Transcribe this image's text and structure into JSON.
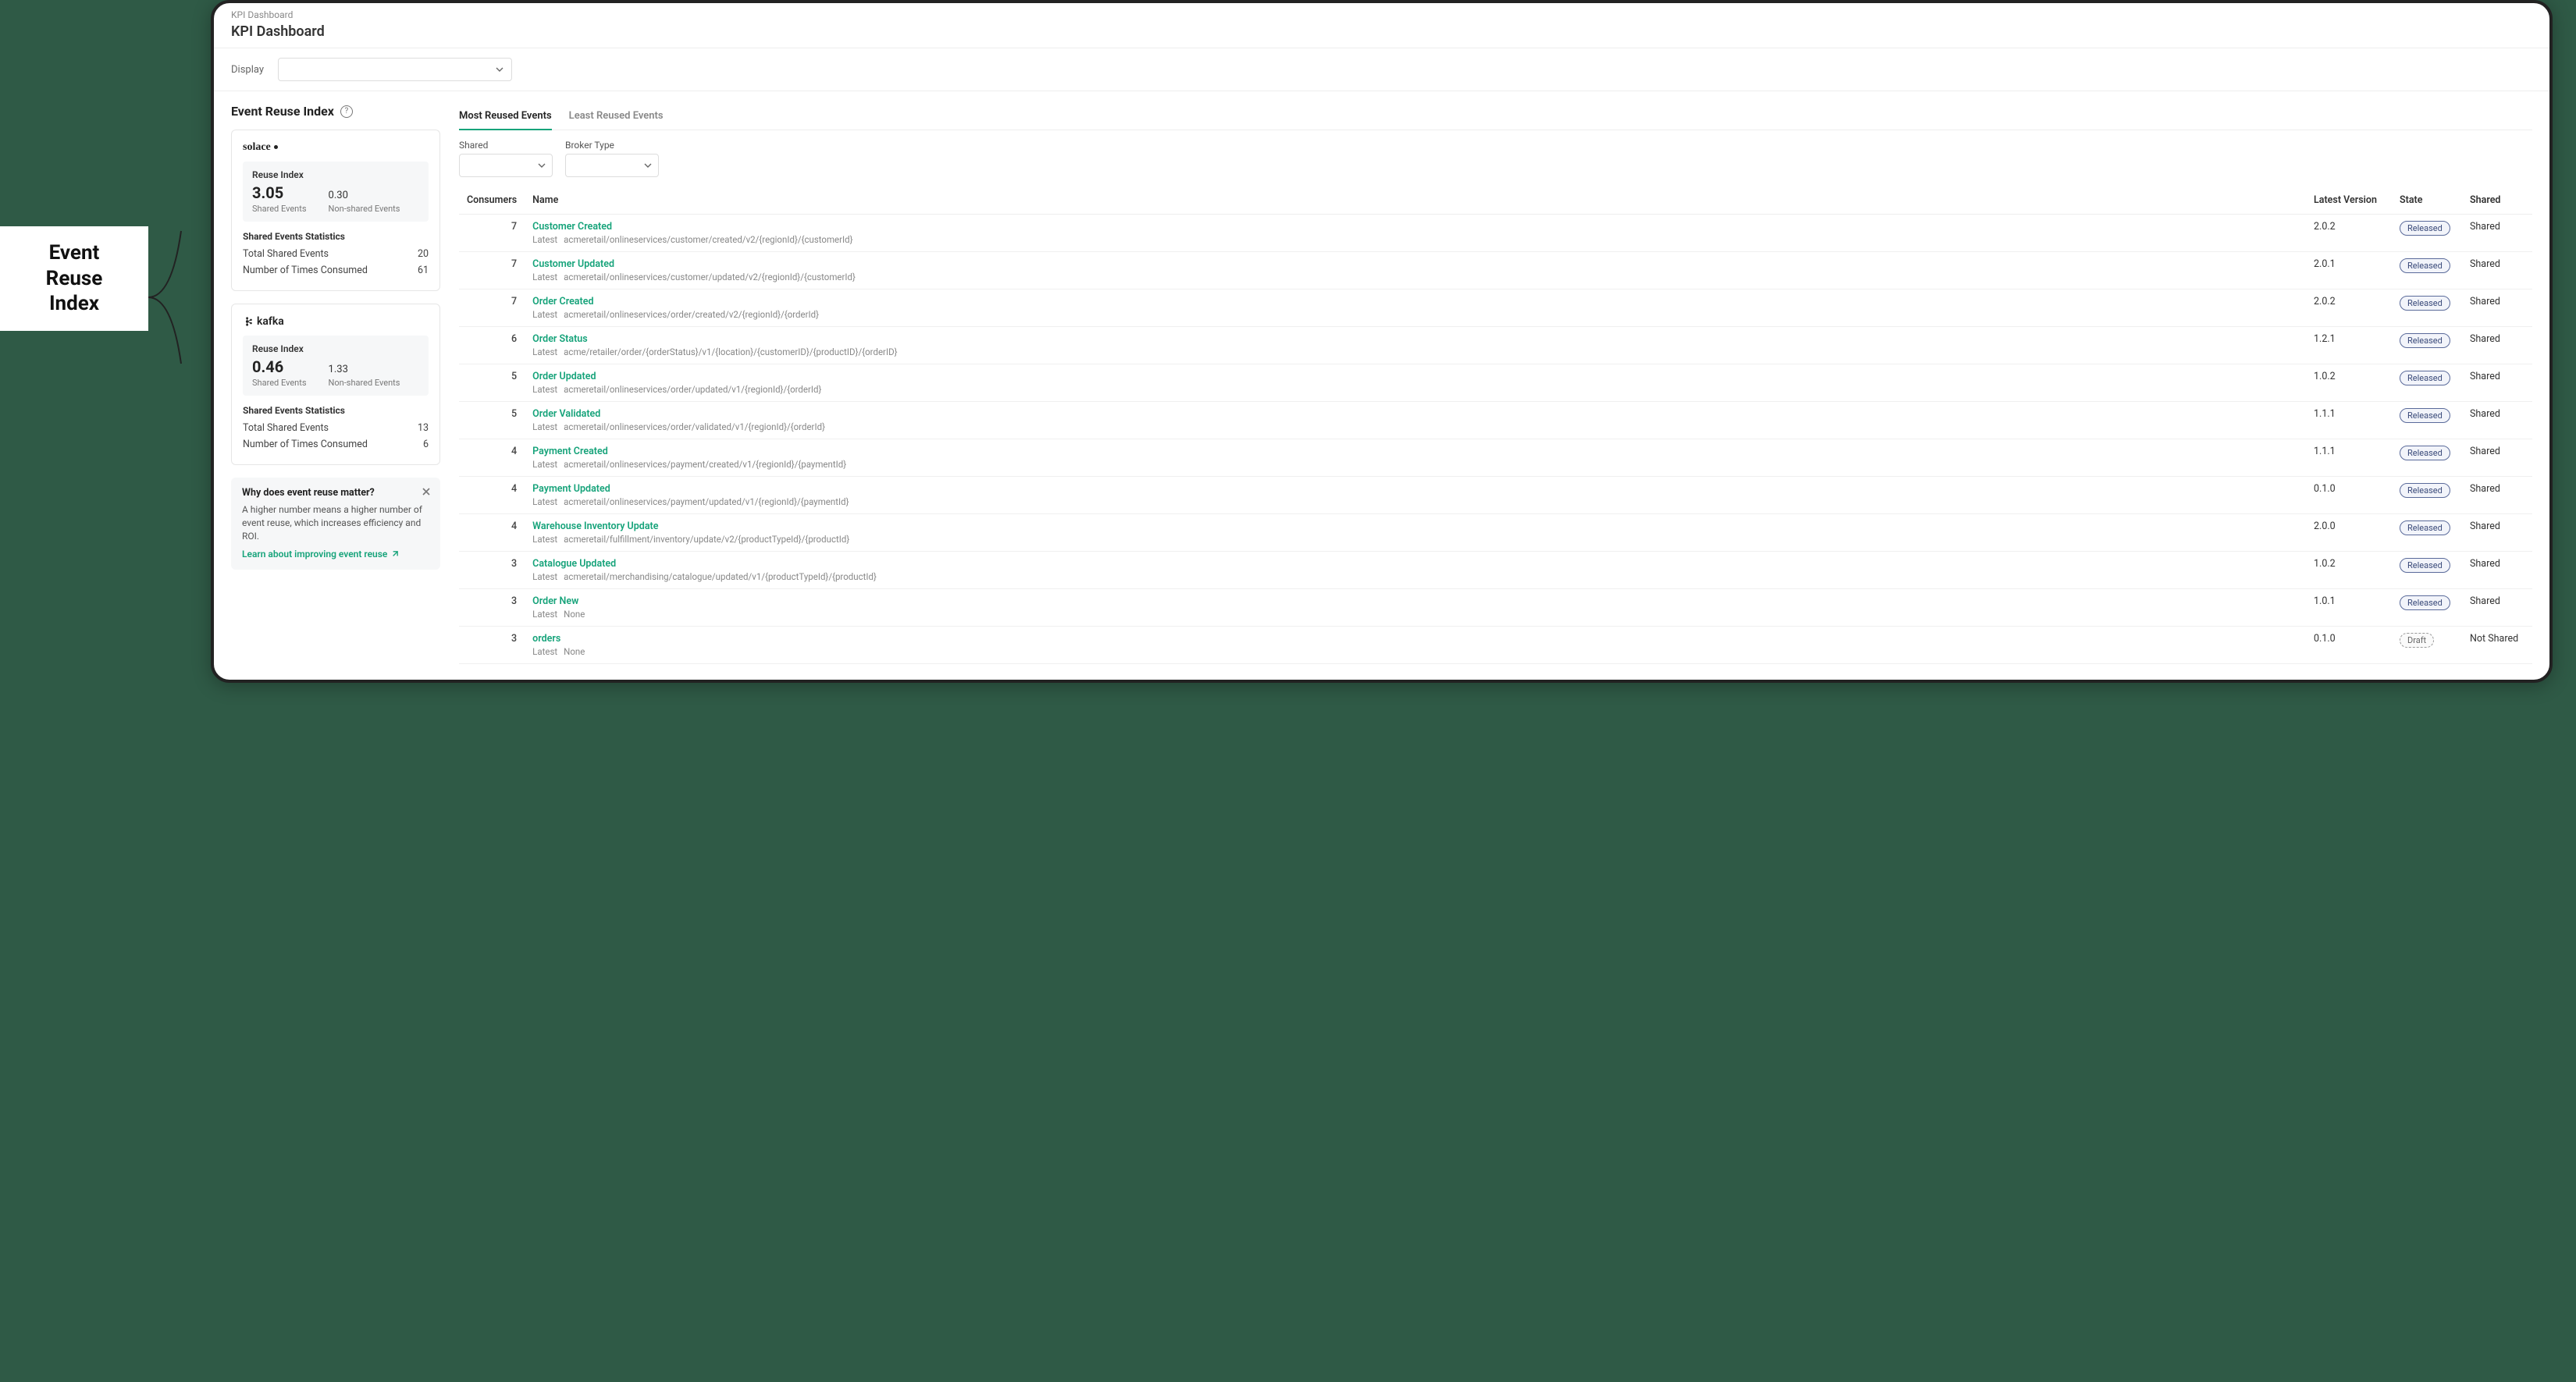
{
  "callout": {
    "line1": "Event",
    "line2": "Reuse",
    "line3": "Index"
  },
  "breadcrumb": "KPI Dashboard",
  "page_title": "KPI Dashboard",
  "display_label": "Display",
  "section_title": "Event Reuse Index",
  "stats": {
    "index_header": "Reuse Index",
    "shared_label": "Shared Events",
    "nonshared_label": "Non-shared Events",
    "stats_header": "Shared Events Statistics",
    "total_shared_label": "Total Shared Events",
    "times_consumed_label": "Number of Times Consumed"
  },
  "brokers": [
    {
      "brand": "solace",
      "brand_kind": "solace",
      "shared_index": "3.05",
      "nonshared_index": "0.30",
      "total_shared": "20",
      "times_consumed": "61"
    },
    {
      "brand": "kafka",
      "brand_kind": "kafka",
      "shared_index": "0.46",
      "nonshared_index": "1.33",
      "total_shared": "13",
      "times_consumed": "6"
    }
  ],
  "info": {
    "title": "Why does event reuse matter?",
    "body": "A higher number means a higher number of event reuse, which increases efficiency and ROI.",
    "link_text": "Learn about improving event reuse"
  },
  "tabs": {
    "most": "Most Reused Events",
    "least": "Least Reused Events"
  },
  "filters": {
    "shared_label": "Shared",
    "broker_label": "Broker Type"
  },
  "columns": {
    "consumers": "Consumers",
    "name": "Name",
    "latest_version": "Latest Version",
    "state": "State",
    "shared": "Shared"
  },
  "sub_prefix": "Latest",
  "events": [
    {
      "consumers": "7",
      "name": "Customer Created",
      "topic": "acmeretail/onlineservices/customer/created/v2/{regionId}/{customerId}",
      "version": "2.0.2",
      "state": "Released",
      "shared": "Shared"
    },
    {
      "consumers": "7",
      "name": "Customer Updated",
      "topic": "acmeretail/onlineservices/customer/updated/v2/{regionId}/{customerId}",
      "version": "2.0.1",
      "state": "Released",
      "shared": "Shared"
    },
    {
      "consumers": "7",
      "name": "Order Created",
      "topic": "acmeretail/onlineservices/order/created/v2/{regionId}/{orderId}",
      "version": "2.0.2",
      "state": "Released",
      "shared": "Shared"
    },
    {
      "consumers": "6",
      "name": "Order Status",
      "topic": "acme/retailer/order/{orderStatus}/v1/{location}/{customerID}/{productID}/{orderID}",
      "version": "1.2.1",
      "state": "Released",
      "shared": "Shared"
    },
    {
      "consumers": "5",
      "name": "Order Updated",
      "topic": "acmeretail/onlineservices/order/updated/v1/{regionId}/{orderId}",
      "version": "1.0.2",
      "state": "Released",
      "shared": "Shared"
    },
    {
      "consumers": "5",
      "name": "Order Validated",
      "topic": "acmeretail/onlineservices/order/validated/v1/{regionId}/{orderId}",
      "version": "1.1.1",
      "state": "Released",
      "shared": "Shared"
    },
    {
      "consumers": "4",
      "name": "Payment Created",
      "topic": "acmeretail/onlineservices/payment/created/v1/{regionId}/{paymentId}",
      "version": "1.1.1",
      "state": "Released",
      "shared": "Shared"
    },
    {
      "consumers": "4",
      "name": "Payment Updated",
      "topic": "acmeretail/onlineservices/payment/updated/v1/{regionId}/{paymentId}",
      "version": "0.1.0",
      "state": "Released",
      "shared": "Shared"
    },
    {
      "consumers": "4",
      "name": "Warehouse Inventory Update",
      "topic": "acmeretail/fulfillment/inventory/update/v2/{productTypeId}/{productId}",
      "version": "2.0.0",
      "state": "Released",
      "shared": "Shared"
    },
    {
      "consumers": "3",
      "name": "Catalogue Updated",
      "topic": "acmeretail/merchandising/catalogue/updated/v1/{productTypeId}/{productId}",
      "version": "1.0.2",
      "state": "Released",
      "shared": "Shared"
    },
    {
      "consumers": "3",
      "name": "Order New",
      "topic": "None",
      "version": "1.0.1",
      "state": "Released",
      "shared": "Shared"
    },
    {
      "consumers": "3",
      "name": "orders",
      "topic": "None",
      "version": "0.1.0",
      "state": "Draft",
      "shared": "Not Shared"
    }
  ]
}
